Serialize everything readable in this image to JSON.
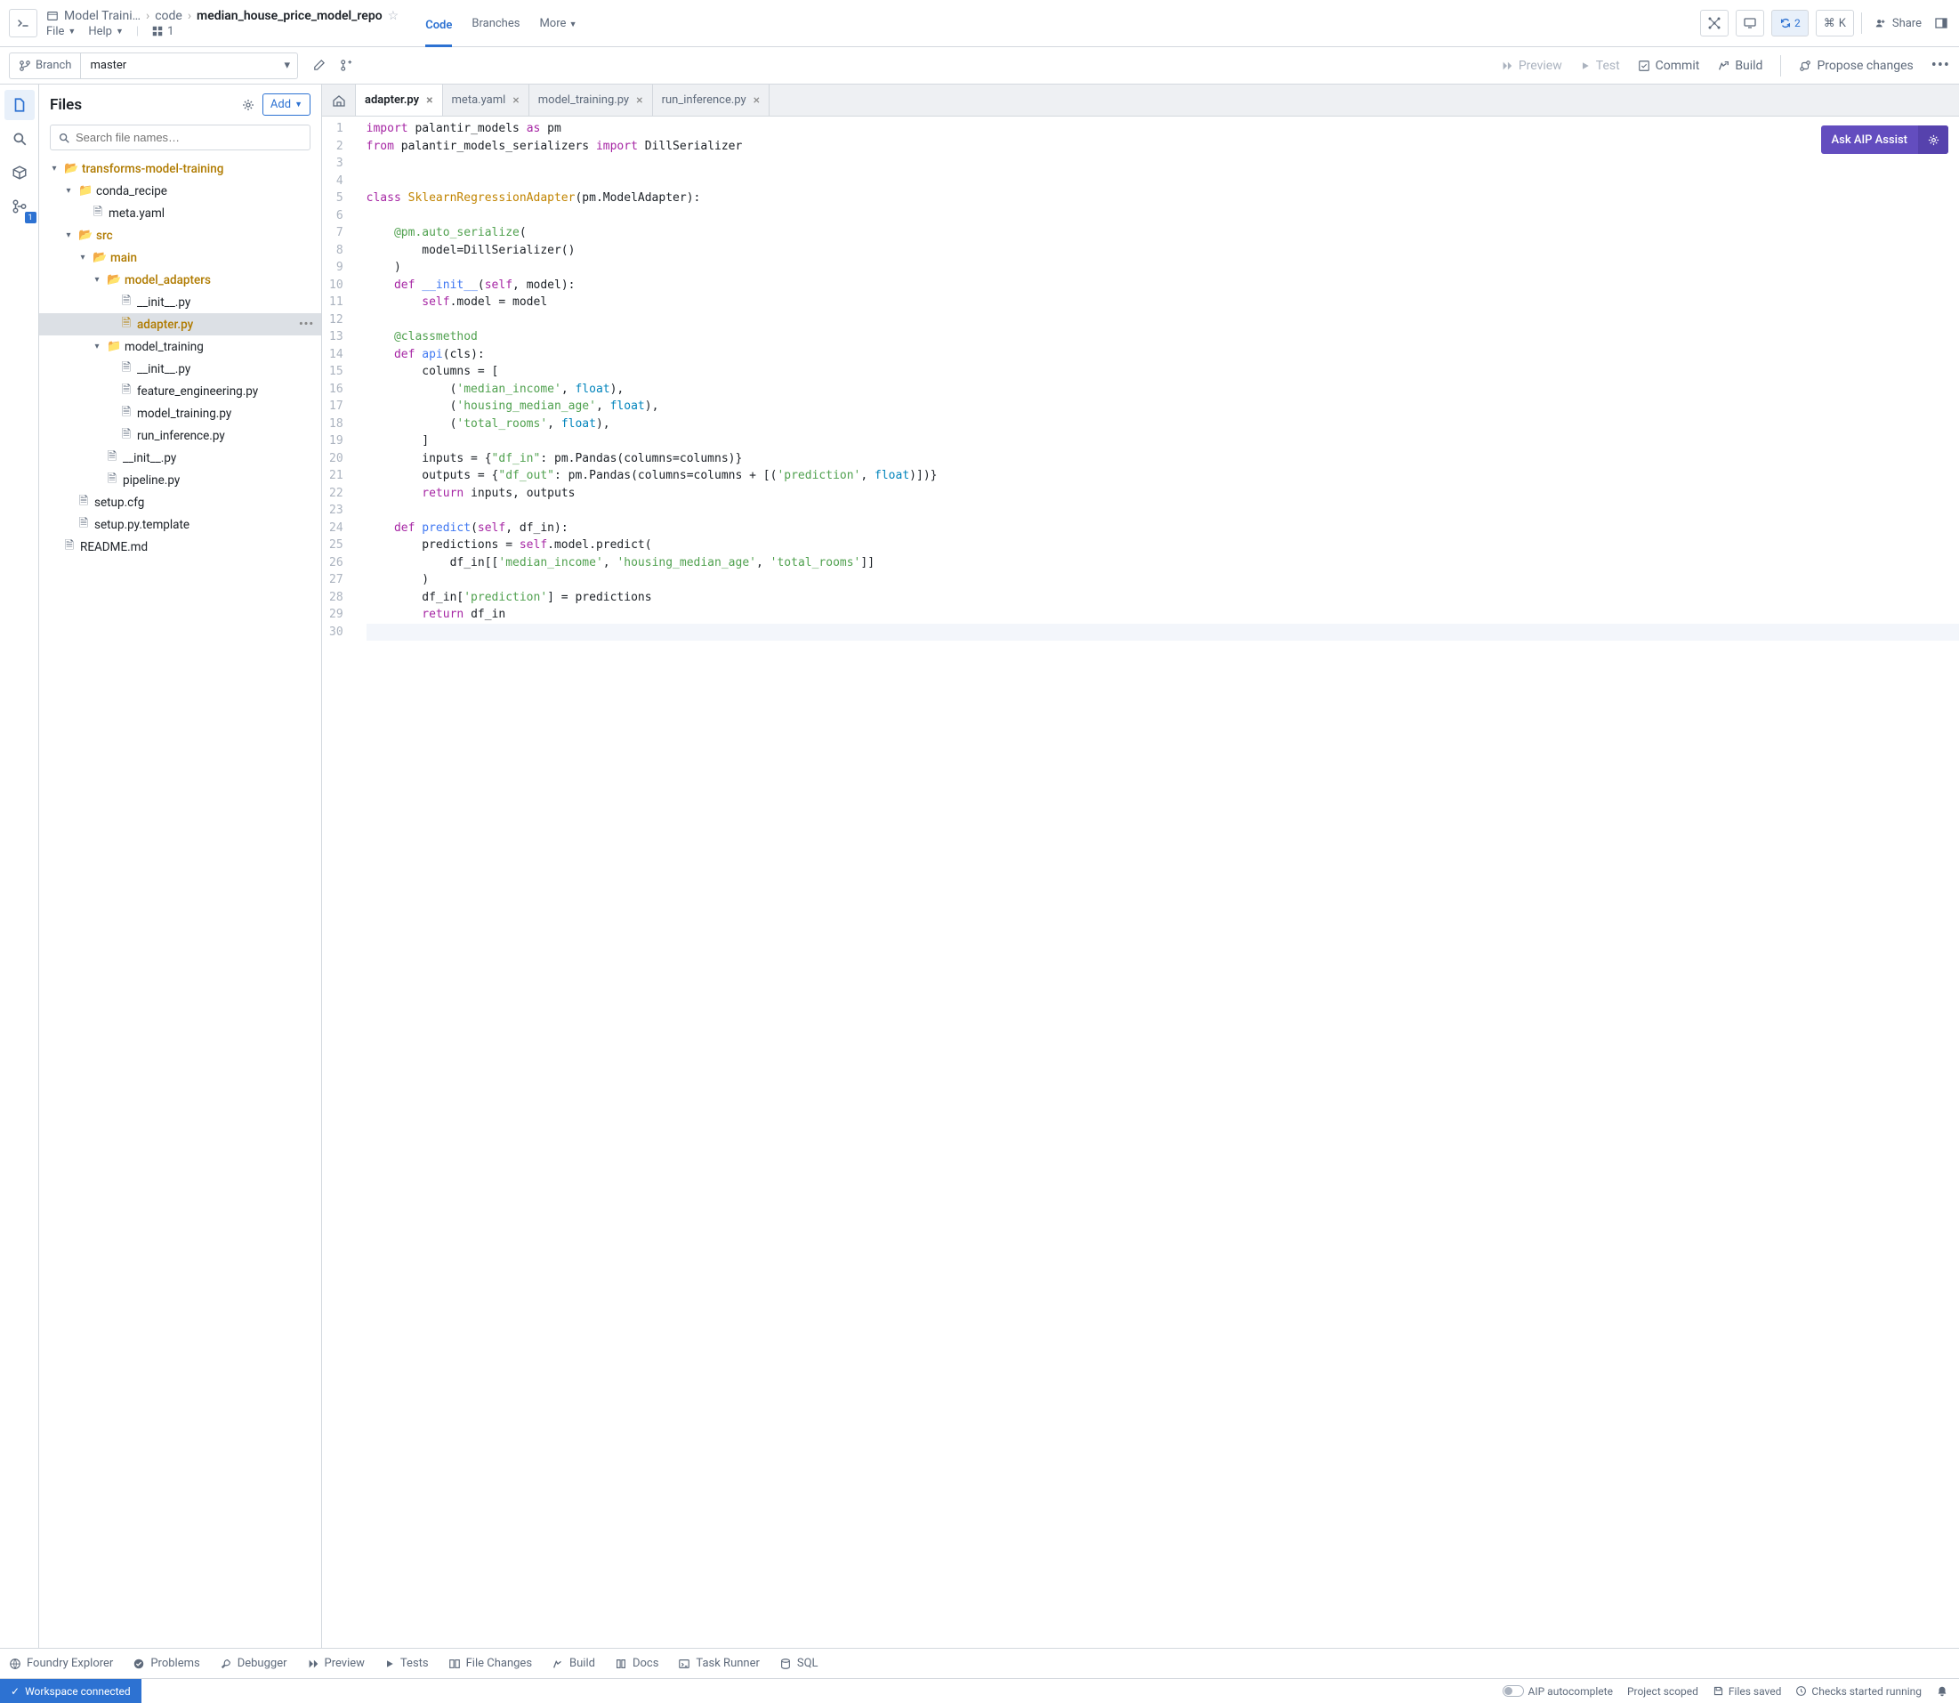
{
  "breadcrumb": {
    "root": "Model Traini…",
    "mid": "code",
    "current": "median_house_price_model_repo"
  },
  "menu": {
    "file": "File",
    "help": "Help",
    "office_count": "1"
  },
  "topnav": {
    "code": "Code",
    "branches": "Branches",
    "more": "More"
  },
  "topright": {
    "sync_count": "2",
    "cmd_key": "K",
    "share": "Share"
  },
  "branch": {
    "label": "Branch",
    "value": "master"
  },
  "actions": {
    "preview": "Preview",
    "test": "Test",
    "commit": "Commit",
    "build": "Build",
    "propose": "Propose changes"
  },
  "rail": {
    "badge": "1"
  },
  "sidebar": {
    "title": "Files",
    "add": "Add",
    "search_placeholder": "Search file names…",
    "tree": {
      "n0": "transforms-model-training",
      "n1": "conda_recipe",
      "n2": "meta.yaml",
      "n3": "src",
      "n4": "main",
      "n5": "model_adapters",
      "n6": "__init__.py",
      "n7": "adapter.py",
      "n8": "model_training",
      "n9": "__init__.py",
      "n10": "feature_engineering.py",
      "n11": "model_training.py",
      "n12": "run_inference.py",
      "n13": "__init__.py",
      "n14": "pipeline.py",
      "n15": "setup.cfg",
      "n16": "setup.py.template",
      "n17": "README.md"
    }
  },
  "tabs": {
    "t0": "adapter.py",
    "t1": "meta.yaml",
    "t2": "model_training.py",
    "t3": "run_inference.py"
  },
  "assist": "Ask AIP Assist",
  "code_lines": [
    1,
    2,
    3,
    4,
    5,
    6,
    7,
    8,
    9,
    10,
    11,
    12,
    13,
    14,
    15,
    16,
    17,
    18,
    19,
    20,
    21,
    22,
    23,
    24,
    25,
    26,
    27,
    28,
    29,
    30
  ],
  "bottom": {
    "explorer": "Foundry Explorer",
    "problems": "Problems",
    "debugger": "Debugger",
    "preview": "Preview",
    "tests": "Tests",
    "changes": "File Changes",
    "build": "Build",
    "docs": "Docs",
    "task": "Task Runner",
    "sql": "SQL"
  },
  "status": {
    "connected": "Workspace connected",
    "autocomplete": "AIP autocomplete",
    "scoped": "Project scoped",
    "saved": "Files saved",
    "checks": "Checks started running"
  },
  "chart_data": {
    "type": "code",
    "language": "python",
    "filename": "adapter.py",
    "content": "import palantir_models as pm\nfrom palantir_models_serializers import DillSerializer\n\n\nclass SklearnRegressionAdapter(pm.ModelAdapter):\n\n    @pm.auto_serialize(\n        model=DillSerializer()\n    )\n    def __init__(self, model):\n        self.model = model\n\n    @classmethod\n    def api(cls):\n        columns = [\n            ('median_income', float),\n            ('housing_median_age', float),\n            ('total_rooms', float),\n        ]\n        inputs = {\"df_in\": pm.Pandas(columns=columns)}\n        outputs = {\"df_out\": pm.Pandas(columns=columns + [('prediction', float)])}\n        return inputs, outputs\n\n    def predict(self, df_in):\n        predictions = self.model.predict(\n            df_in[['median_income', 'housing_median_age', 'total_rooms']]\n        )\n        df_in['prediction'] = predictions\n        return df_in\n"
  }
}
